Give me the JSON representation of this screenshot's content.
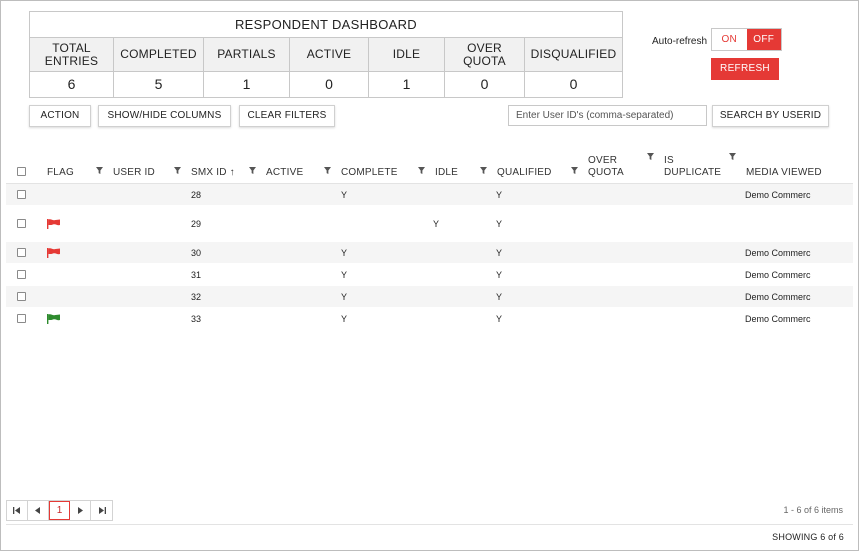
{
  "dashboard": {
    "title": "RESPONDENT DASHBOARD",
    "headers": [
      "TOTAL ENTRIES",
      "COMPLETED",
      "PARTIALS",
      "ACTIVE",
      "IDLE",
      "OVER QUOTA",
      "DISQUALIFIED"
    ],
    "values": [
      "6",
      "5",
      "1",
      "0",
      "1",
      "0",
      "0"
    ]
  },
  "autorefresh": {
    "label": "Auto-refresh",
    "on": "ON",
    "off": "OFF",
    "state": "OFF",
    "refresh": "REFRESH"
  },
  "toolbar": {
    "action": "ACTION",
    "showhide": "SHOW/HIDE COLUMNS",
    "clear": "CLEAR FILTERS",
    "search_placeholder": "Enter User ID's (comma-separated)",
    "search_button": "SEARCH BY USERID"
  },
  "grid": {
    "columns": {
      "flag": "FLAG",
      "userid": "USER ID",
      "smxid": "SMX ID ↑",
      "active": "ACTIVE",
      "complete": "COMPLETE",
      "idle": "IDLE",
      "qualified": "QUALIFIED",
      "overquota_1": "OVER",
      "overquota_2": "QUOTA",
      "duplicate_1": "IS",
      "duplicate_2": "DUPLICATE",
      "media": "MEDIA VIEWED"
    },
    "rows": [
      {
        "flag": "",
        "userid": "",
        "smxid": "28",
        "active": "",
        "complete": "Y",
        "idle": "",
        "qualified": "Y",
        "overquota": "",
        "duplicate": "",
        "media": "Demo Commerc"
      },
      {
        "flag": "red",
        "userid": "",
        "smxid": "29",
        "active": "",
        "complete": "",
        "idle": "Y",
        "qualified": "Y",
        "overquota": "",
        "duplicate": "",
        "media": ""
      },
      {
        "flag": "red",
        "userid": "",
        "smxid": "30",
        "active": "",
        "complete": "Y",
        "idle": "",
        "qualified": "Y",
        "overquota": "",
        "duplicate": "",
        "media": "Demo Commerc"
      },
      {
        "flag": "",
        "userid": "",
        "smxid": "31",
        "active": "",
        "complete": "Y",
        "idle": "",
        "qualified": "Y",
        "overquota": "",
        "duplicate": "",
        "media": "Demo Commerc"
      },
      {
        "flag": "",
        "userid": "",
        "smxid": "32",
        "active": "",
        "complete": "Y",
        "idle": "",
        "qualified": "Y",
        "overquota": "",
        "duplicate": "",
        "media": "Demo Commerc"
      },
      {
        "flag": "green",
        "userid": "",
        "smxid": "33",
        "active": "",
        "complete": "Y",
        "idle": "",
        "qualified": "Y",
        "overquota": "",
        "duplicate": "",
        "media": "Demo Commerc"
      }
    ]
  },
  "pager": {
    "first": "first-page-icon",
    "prev": "prev-page-icon",
    "page": "1",
    "next": "next-page-icon",
    "last": "last-page-icon",
    "items": "1 - 6 of 6 items"
  },
  "footer": {
    "showing": "SHOWING 6 of 6"
  },
  "colors": {
    "accent": "#e53935",
    "flag_red": "#e53935",
    "flag_green": "#2e8b2e"
  }
}
